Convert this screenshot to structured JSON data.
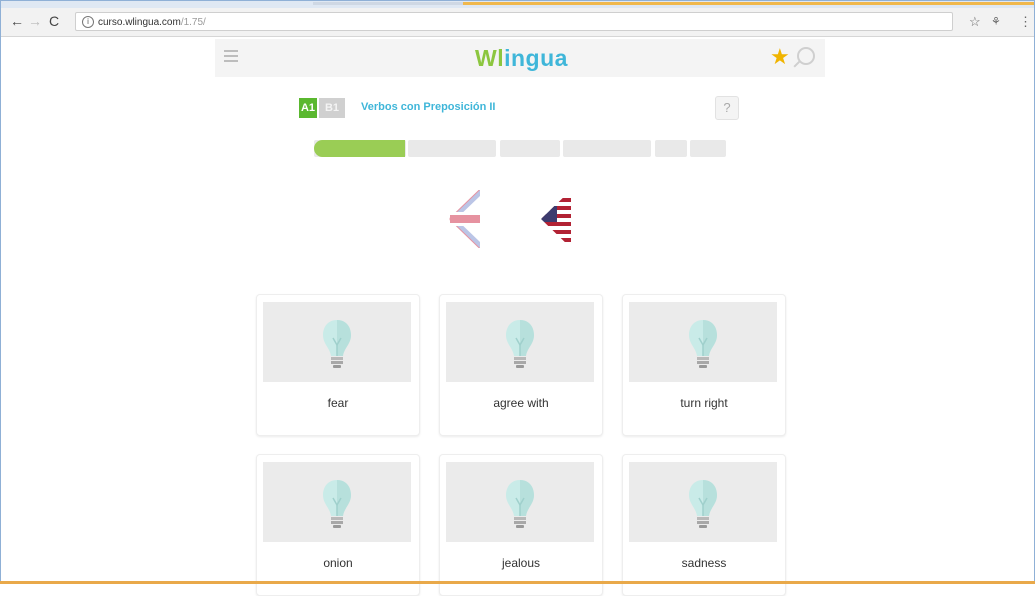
{
  "browser": {
    "back_icon": "back-arrow-icon",
    "forward_icon": "forward-arrow-icon",
    "reload_icon": "reload-icon",
    "url_domain": "curso.wlingua.com",
    "url_path": "/1.75/",
    "bookmark_icon": "star-outline-icon",
    "extension_icon": "extension-icon",
    "menu_icon": "more-vertical-icon"
  },
  "header": {
    "logo_wl": "Wl",
    "logo_ingua": "ingua",
    "menu_icon": "hamburger-icon",
    "favorite_icon": "star-icon",
    "search_icon": "search-icon"
  },
  "lesson": {
    "level_current": "A1",
    "level_next": "B1",
    "title": "Verbos con Preposición II",
    "help": "?"
  },
  "progress": {
    "completed_fraction": 0.22
  },
  "flags": {
    "source": "uk-flag-icon",
    "target": "us-flag-icon"
  },
  "cards": [
    {
      "label": "fear"
    },
    {
      "label": "agree with"
    },
    {
      "label": "turn right"
    },
    {
      "label": "onion"
    },
    {
      "label": "jealous"
    },
    {
      "label": "sadness"
    }
  ],
  "colors": {
    "green": "#8cc63f",
    "blue": "#3fb6d9",
    "star": "#f0b400"
  }
}
